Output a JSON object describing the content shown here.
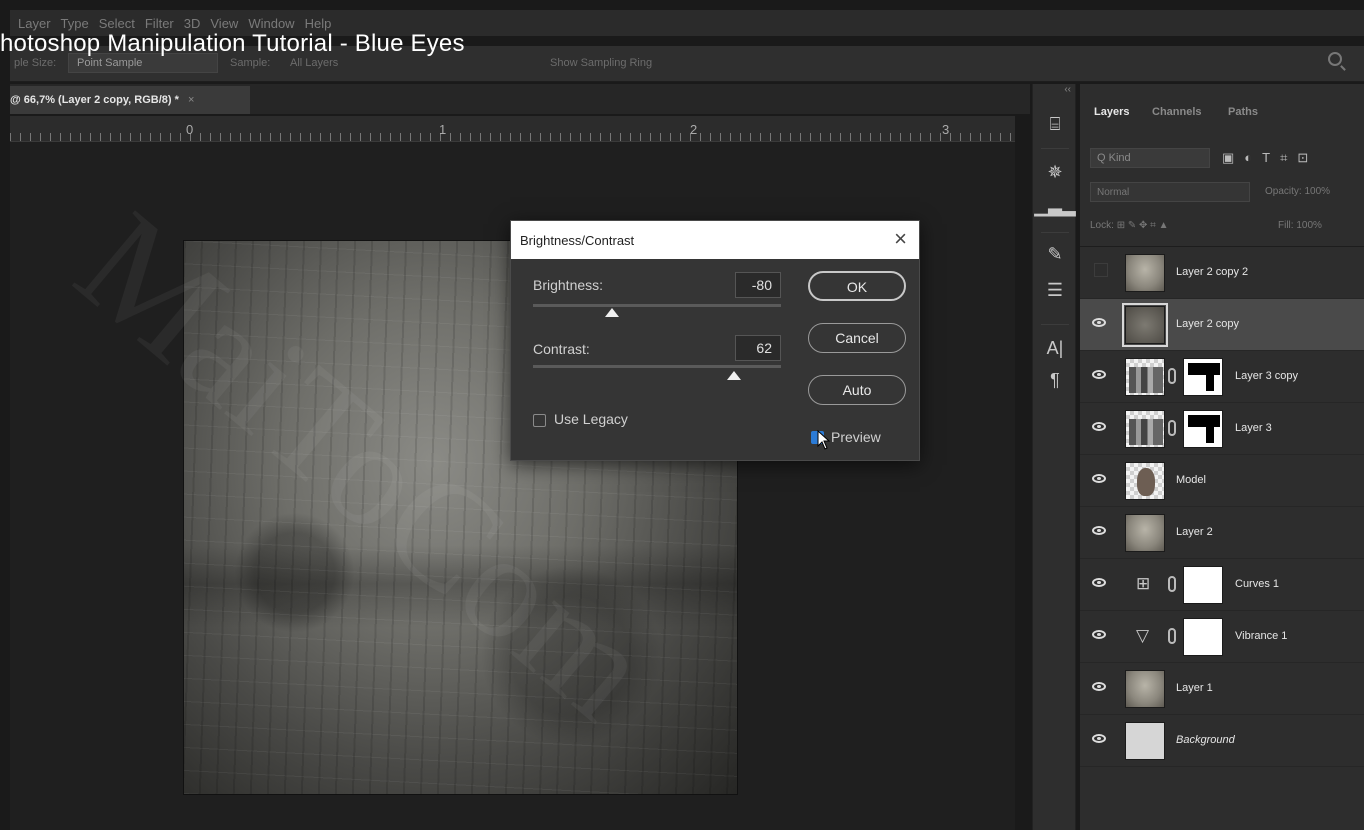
{
  "video": {
    "title": "hotoshop Manipulation Tutorial - Blue Eyes"
  },
  "menu": {
    "items": [
      "Layer",
      "Type",
      "Select",
      "Filter",
      "3D",
      "View",
      "Window",
      "Help"
    ]
  },
  "options_bar": {
    "sample_size_label": "ple Size:",
    "sample_size_value": "Point Sample",
    "sample_label": "Sample:",
    "sample_value": "All Layers",
    "show_sampling_ring": "Show Sampling Ring"
  },
  "document_tab": {
    "title": "@ 66,7% (Layer 2 copy, RGB/8) *",
    "close": "×"
  },
  "ruler": {
    "marks": [
      "0",
      "1",
      "2",
      "3"
    ]
  },
  "dialog": {
    "title": "Brightness/Contrast",
    "close": "×",
    "brightness_label": "Brightness:",
    "brightness_value": "-80",
    "brightness_position": 0.32,
    "contrast_label": "Contrast:",
    "contrast_value": "62",
    "contrast_position": 0.81,
    "ok_label": "OK",
    "cancel_label": "Cancel",
    "auto_label": "Auto",
    "use_legacy_label": "Use Legacy",
    "use_legacy_checked": false,
    "preview_label": "Preview",
    "preview_checked": true
  },
  "layers_panel": {
    "tabs": [
      "Layers",
      "Channels",
      "Paths"
    ],
    "active_tab": "Layers",
    "kind_label": "Q Kind",
    "blend_mode": "Normal",
    "opacity_label": "Opacity:",
    "opacity_value": "100%",
    "lock_label": "Lock:",
    "fill_label": "Fill:",
    "fill_value": "100%",
    "layers": [
      {
        "name": "Layer 2 copy 2",
        "visible": false,
        "thumb": "texture",
        "selected": false
      },
      {
        "name": "Layer 2 copy",
        "visible": true,
        "thumb": "texture-selected",
        "selected": true
      },
      {
        "name": "Layer 3 copy",
        "visible": true,
        "thumb": "city",
        "mask": true,
        "selected": false
      },
      {
        "name": "Layer 3",
        "visible": true,
        "thumb": "city",
        "mask": true,
        "selected": false
      },
      {
        "name": "Model",
        "visible": true,
        "thumb": "model",
        "selected": false
      },
      {
        "name": "Layer 2",
        "visible": true,
        "thumb": "texture",
        "selected": false
      },
      {
        "name": "Curves 1",
        "visible": true,
        "thumb": "curves-adjustment",
        "mask": true,
        "selected": false
      },
      {
        "name": "Vibrance 1",
        "visible": true,
        "thumb": "vibrance-adjustment",
        "mask": true,
        "selected": false
      },
      {
        "name": "Layer 1",
        "visible": true,
        "thumb": "texture",
        "selected": false
      },
      {
        "name": "Background",
        "visible": true,
        "thumb": "background",
        "selected": false,
        "italic": true
      }
    ]
  },
  "watermark": {
    "text": "MaiToCom"
  }
}
